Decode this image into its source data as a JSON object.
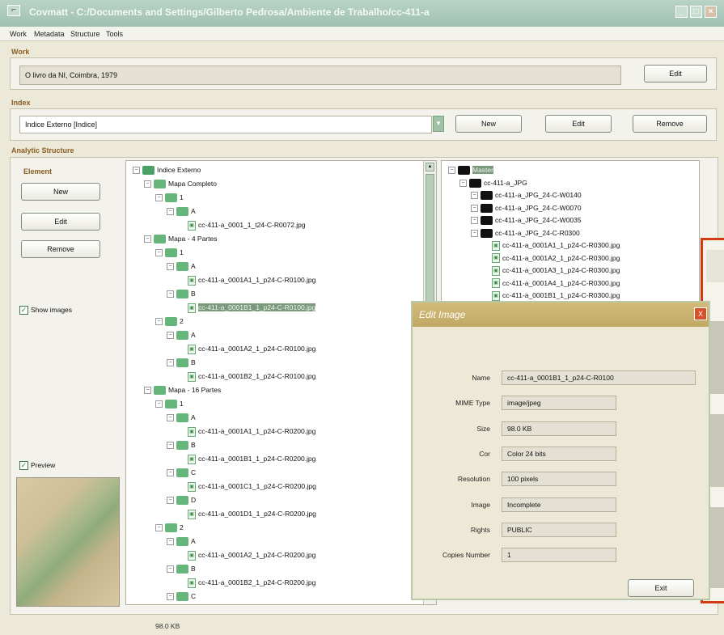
{
  "window": {
    "title": "Covmatt - C:/Documents and Settings/Gilberto Pedrosa/Ambiente de Trabalho/cc-411-a",
    "app_icon": "app-icon"
  },
  "menu": [
    "Work",
    "Metadata",
    "Structure",
    "Tools"
  ],
  "work": {
    "label": "Work",
    "value": "O livro da NI, Coimbra, 1979",
    "edit_label": "Edit"
  },
  "index": {
    "label": "Index",
    "value": "Indice Externo  [Indice]",
    "new_label": "New",
    "edit_label": "Edit",
    "remove_label": "Remove"
  },
  "analytic": {
    "label": "Analytic Structure",
    "element_label": "Element",
    "new_label": "New",
    "edit_label": "Edit",
    "remove_label": "Remove",
    "show_images_label": "Show images",
    "preview_label": "Preview",
    "size_status": "98.0 KB"
  },
  "left_tree": [
    {
      "text": "Indice Externo",
      "type": "folder",
      "level": 0
    },
    {
      "text": "Mapa Completo",
      "type": "folder",
      "level": 1
    },
    {
      "text": "1",
      "type": "folder",
      "level": 2
    },
    {
      "text": "A",
      "type": "folder",
      "level": 3
    },
    {
      "text": "cc-411-a_0001_1_t24-C-R0072.jpg",
      "type": "file",
      "level": 4
    },
    {
      "text": "Mapa - 4 Partes",
      "type": "folder",
      "level": 1
    },
    {
      "text": "1",
      "type": "folder",
      "level": 2
    },
    {
      "text": "A",
      "type": "folder",
      "level": 3
    },
    {
      "text": "cc-411-a_0001A1_1_p24-C-R0100.jpg",
      "type": "file",
      "level": 4
    },
    {
      "text": "B",
      "type": "folder",
      "level": 3
    },
    {
      "text": "cc-411-a_0001B1_1_p24-C-R0100.jpg",
      "type": "file",
      "level": 4,
      "selected": true
    },
    {
      "text": "2",
      "type": "folder",
      "level": 2
    },
    {
      "text": "A",
      "type": "folder",
      "level": 3
    },
    {
      "text": "cc-411-a_0001A2_1_p24-C-R0100.jpg",
      "type": "file",
      "level": 4
    },
    {
      "text": "B",
      "type": "folder",
      "level": 3
    },
    {
      "text": "cc-411-a_0001B2_1_p24-C-R0100.jpg",
      "type": "file",
      "level": 4
    },
    {
      "text": "Mapa - 16 Partes",
      "type": "folder",
      "level": 1
    },
    {
      "text": "1",
      "type": "folder",
      "level": 2
    },
    {
      "text": "A",
      "type": "folder",
      "level": 3
    },
    {
      "text": "cc-411-a_0001A1_1_p24-C-R0200.jpg",
      "type": "file",
      "level": 4
    },
    {
      "text": "B",
      "type": "folder",
      "level": 3
    },
    {
      "text": "cc-411-a_0001B1_1_p24-C-R0200.jpg",
      "type": "file",
      "level": 4
    },
    {
      "text": "C",
      "type": "folder",
      "level": 3
    },
    {
      "text": "cc-411-a_0001C1_1_p24-C-R0200.jpg",
      "type": "file",
      "level": 4
    },
    {
      "text": "D",
      "type": "folder",
      "level": 3
    },
    {
      "text": "cc-411-a_0001D1_1_p24-C-R0200.jpg",
      "type": "file",
      "level": 4
    },
    {
      "text": "2",
      "type": "folder",
      "level": 2
    },
    {
      "text": "A",
      "type": "folder",
      "level": 3
    },
    {
      "text": "cc-411-a_0001A2_1_p24-C-R0200.jpg",
      "type": "file",
      "level": 4
    },
    {
      "text": "B",
      "type": "folder",
      "level": 3
    },
    {
      "text": "cc-411-a_0001B2_1_p24-C-R0200.jpg",
      "type": "file",
      "level": 4
    },
    {
      "text": "C",
      "type": "folder",
      "level": 3
    }
  ],
  "right_tree": [
    {
      "text": "Master",
      "type": "black",
      "level": 0,
      "selected": true
    },
    {
      "text": "cc-411-a_JPG",
      "type": "black",
      "level": 1
    },
    {
      "text": "cc-411-a_JPG_24-C-W0140",
      "type": "black",
      "level": 2
    },
    {
      "text": "cc-411-a_JPG_24-C-W0070",
      "type": "black",
      "level": 2
    },
    {
      "text": "cc-411-a_JPG_24-C-W0035",
      "type": "black",
      "level": 2
    },
    {
      "text": "cc-411-a_JPG_24-C-R0300",
      "type": "black",
      "level": 2
    },
    {
      "text": "cc-411-a_0001A1_1_p24-C-R0300.jpg",
      "type": "file",
      "level": 3
    },
    {
      "text": "cc-411-a_0001A2_1_p24-C-R0300.jpg",
      "type": "file",
      "level": 3
    },
    {
      "text": "cc-411-a_0001A3_1_p24-C-R0300.jpg",
      "type": "file",
      "level": 3
    },
    {
      "text": "cc-411-a_0001A4_1_p24-C-R0300.jpg",
      "type": "file",
      "level": 3
    },
    {
      "text": "cc-411-a_0001B1_1_p24-C-R0300.jpg",
      "type": "file",
      "level": 3
    }
  ],
  "edit_image": {
    "title": "Edit Image",
    "close_label": "X",
    "fields": [
      {
        "label": "Name",
        "value": "cc-411-a_0001B1_1_p24-C-R0100"
      },
      {
        "label": "MIME Type",
        "value": "image/jpeg"
      },
      {
        "label": "Size",
        "value": "98.0 KB"
      },
      {
        "label": "Cor",
        "value": "Color 24 bits"
      },
      {
        "label": "Resolution",
        "value": "100 pixels"
      },
      {
        "label": "Image",
        "value": "Incomplete"
      },
      {
        "label": "Rights",
        "value": "PUBLIC"
      },
      {
        "label": "Copies Number",
        "value": "1"
      }
    ],
    "exit_label": "Exit"
  }
}
